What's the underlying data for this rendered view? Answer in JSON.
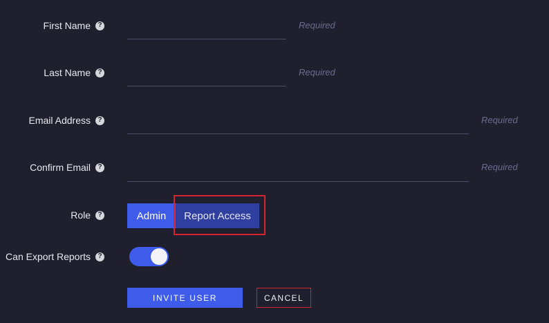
{
  "form": {
    "first_name": {
      "label": "First Name",
      "value": "",
      "required_hint": "Required"
    },
    "last_name": {
      "label": "Last Name",
      "value": "",
      "required_hint": "Required"
    },
    "email": {
      "label": "Email Address",
      "value": "",
      "required_hint": "Required"
    },
    "confirm_email": {
      "label": "Confirm Email",
      "value": "",
      "required_hint": "Required"
    },
    "role": {
      "label": "Role",
      "options": [
        "Admin",
        "Report Access"
      ],
      "selected": "Admin"
    },
    "can_export": {
      "label": "Can Export Reports",
      "enabled": true
    },
    "help_glyph": "?"
  },
  "actions": {
    "invite_label": "INVITE USER",
    "cancel_label": "CANCEL"
  },
  "colors": {
    "background": "#1f1f2e",
    "accent": "#3f5bea",
    "accent_dim": "#2e3fa0",
    "highlight": "#d5232f",
    "placeholder": "#6a6d8f"
  },
  "icons": {
    "help": "question-circle-icon",
    "toggle_knob": "toggle-knob"
  }
}
